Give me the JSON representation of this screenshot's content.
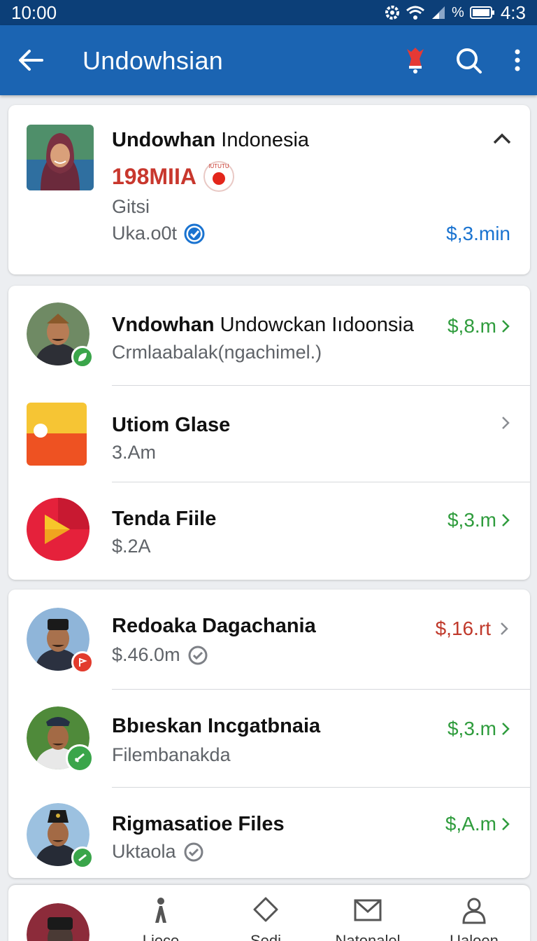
{
  "status_bar": {
    "time": "10:00",
    "battery": "4:3",
    "signal_text": "%"
  },
  "app_bar": {
    "title": "Undowhsian"
  },
  "profile": {
    "name_bold": "Undowhan",
    "name_rest": " Indonesia",
    "value": "198MIIA",
    "stamp_text": "IUTUTU",
    "label": "Gitsi",
    "handle": "Uka.o0t",
    "amount": "$,3.min"
  },
  "list_group_1": [
    {
      "name_bold": "Vndowhan",
      "name_rest": " Undowckan Iıdoonsia",
      "sub": "Crmlaabalak(ngachimel.)",
      "amount": "$,8.m",
      "amount_color": "#2f9c3d"
    },
    {
      "name_bold": "Utiom Glase",
      "name_rest": "",
      "sub": "3.Am",
      "amount": "",
      "amount_color": "#2f9c3d"
    },
    {
      "name_bold": "Tenda Fiile",
      "name_rest": "",
      "sub": "$.2A",
      "amount": "$,3.m",
      "amount_color": "#2f9c3d"
    }
  ],
  "list_group_2": [
    {
      "name_bold": "Redoaka Dagachania",
      "sub": "$.46.0m",
      "amount": "$,16.rt",
      "amount_color": "#c0392b"
    },
    {
      "name_bold": "Bbıeskan Incgatbnaia",
      "sub": "Filembanakda",
      "amount": "$,3.m",
      "amount_color": "#2f9c3d"
    },
    {
      "name_bold": "Rigmasatioe Files",
      "sub": "Uktaola",
      "amount": "$,A.m",
      "amount_color": "#2f9c3d"
    }
  ],
  "bottom_nav": {
    "items": [
      {
        "label": "Liece",
        "icon": "person-walk-icon"
      },
      {
        "label": "Sedi",
        "icon": "tag-icon"
      },
      {
        "label": "Natonalel",
        "icon": "mail-icon"
      },
      {
        "label": "Ualoen",
        "icon": "profile-icon"
      }
    ]
  },
  "colors": {
    "primary": "#1b64b2",
    "status_bar": "#0c3f78",
    "positive": "#2f9c3d",
    "negative": "#c0392b",
    "link": "#1a73d0"
  }
}
